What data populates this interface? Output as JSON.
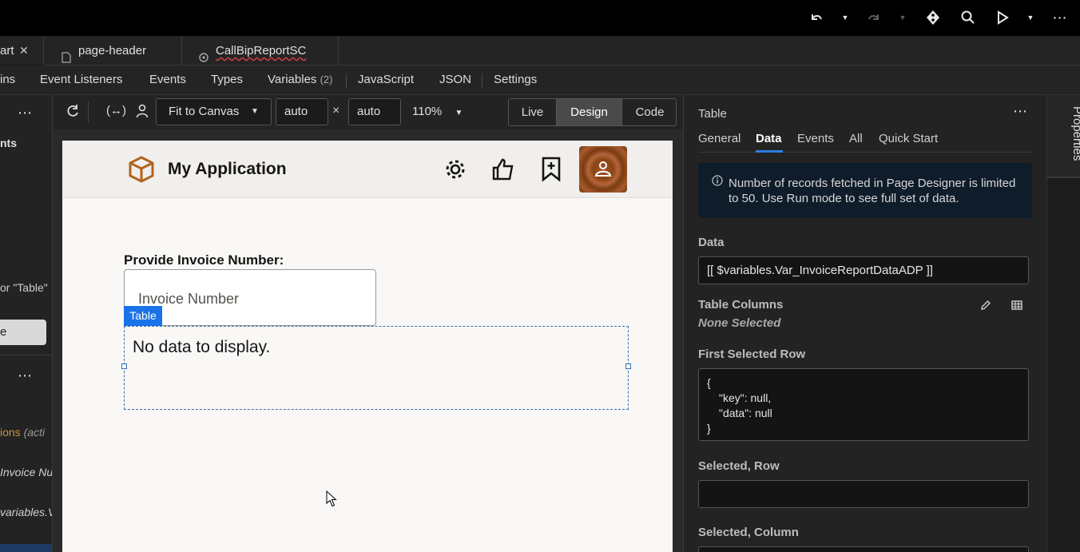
{
  "topbar": {
    "icons": [
      "undo-icon",
      "chevron-down-icon",
      "redo-icon",
      "chevron-down-icon",
      "git-icon",
      "search-icon",
      "play-icon",
      "chevron-down-icon",
      "more-icon"
    ]
  },
  "tabs": [
    {
      "label": "art",
      "closable": true
    },
    {
      "label": "page-header",
      "icon": "file-icon"
    },
    {
      "label": "CallBipReportSC",
      "icon": "action-chain-icon"
    }
  ],
  "subtabs": [
    {
      "label": "ins"
    },
    {
      "label": "Event Listeners"
    },
    {
      "label": "Events"
    },
    {
      "label": "Types"
    },
    {
      "label": "Variables",
      "count": "(2)"
    },
    {
      "label": "JavaScript"
    },
    {
      "label": "JSON"
    },
    {
      "label": "Settings"
    }
  ],
  "leftpanel": {
    "heading": "nts",
    "search_hint": "or \"Table\"",
    "button_label": "e",
    "item_actions": "ions",
    "item_actions_note": "(acti",
    "item_invoice": "Invoice Nu",
    "item_variables": "variables.V"
  },
  "canvas_toolbar": {
    "fit_label": "Fit to Canvas",
    "width_value": "auto",
    "times": "×",
    "height_value": "auto",
    "zoom": "110%",
    "modes": [
      "Live",
      "Design",
      "Code"
    ],
    "active_mode": "Design"
  },
  "app": {
    "title": "My Application",
    "invoice_label": "Provide Invoice Number:",
    "invoice_placeholder": "Invoice Number",
    "table_tag": "Table",
    "no_data": "No data to display."
  },
  "properties": {
    "title": "Table",
    "tabs": [
      "General",
      "Data",
      "Events",
      "All",
      "Quick Start"
    ],
    "active_tab": "Data",
    "info": "Number of records fetched in Page Designer is limited to 50. Use Run mode to see full set of data.",
    "data_label": "Data",
    "data_value": "[[ $variables.Var_InvoiceReportDataADP ]]",
    "columns_label": "Table Columns",
    "columns_value": "None Selected",
    "first_row_label": "First Selected Row",
    "first_row_lines": [
      "{",
      "\"key\": null,",
      "\"data\": null",
      "}"
    ],
    "selected_row_label": "Selected, Row",
    "selected_row_value": "",
    "selected_col_label": "Selected, Column",
    "side_tab": "Properties"
  },
  "colors": {
    "accent": "#2d7ee0",
    "active_tab_underline": "#2d7ee0",
    "info_bg": "#0f1d2a"
  }
}
